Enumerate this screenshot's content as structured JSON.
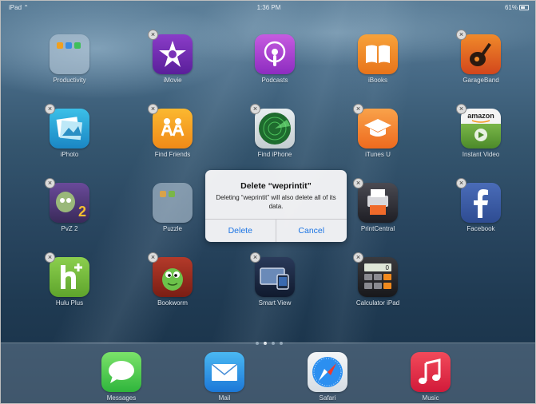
{
  "status_bar": {
    "device": "iPad",
    "time": "1:36 PM",
    "battery": "61%"
  },
  "home_apps": [
    {
      "name": "Productivity",
      "deletable": false
    },
    {
      "name": "iMovie",
      "deletable": true
    },
    {
      "name": "Podcasts",
      "deletable": false
    },
    {
      "name": "iBooks",
      "deletable": false
    },
    {
      "name": "GarageBand",
      "deletable": true
    },
    {
      "name": "iPhoto",
      "deletable": true
    },
    {
      "name": "Find Friends",
      "deletable": true
    },
    {
      "name": "Find iPhone",
      "deletable": true
    },
    {
      "name": "iTunes U",
      "deletable": true
    },
    {
      "name": "Instant Video",
      "deletable": true
    },
    {
      "name": "PvZ 2",
      "deletable": true
    },
    {
      "name": "Puzzle",
      "deletable": false
    },
    {
      "name": "PrintCentral",
      "deletable": true
    },
    {
      "name": "Facebook",
      "deletable": true
    },
    {
      "name": "Hulu Plus",
      "deletable": true
    },
    {
      "name": "Bookworm",
      "deletable": true
    },
    {
      "name": "Smart View",
      "deletable": true
    },
    {
      "name": "Calculator iPad",
      "deletable": true
    }
  ],
  "dock_apps": [
    "Messages",
    "Mail",
    "Safari",
    "Music"
  ],
  "page_indicator": {
    "pages": 4,
    "current": 2
  },
  "alert": {
    "title": "Delete “weprintit”",
    "message": "Deleting “weprintit” will also delete all of its data.",
    "delete_label": "Delete",
    "cancel_label": "Cancel"
  },
  "icon_labels": {
    "amazon": "amazon",
    "calc_display": "0"
  },
  "accent_colors": {
    "alert_button": "#1b74e4"
  }
}
